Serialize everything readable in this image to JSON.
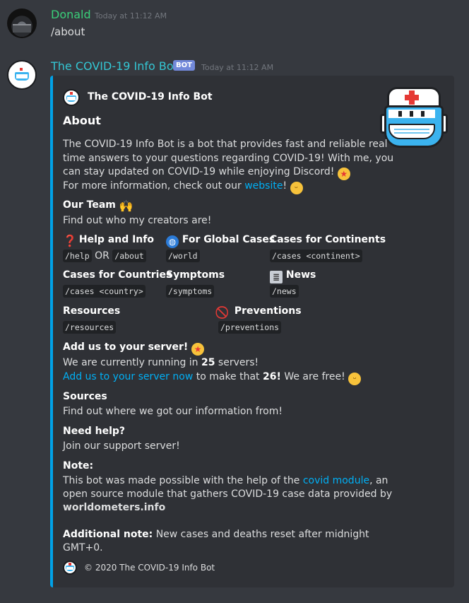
{
  "msg1": {
    "author": "Donald",
    "author_color": "#3ad07a",
    "timestamp": "Today at 11:12 AM",
    "text": "/about"
  },
  "msg2": {
    "author": "The COVID-19 Info Bot",
    "author_color": "#34c6d3",
    "badge": "BOT",
    "timestamp": "Today at 11:12 AM"
  },
  "embed": {
    "accent_color": "#00a2e8",
    "author_name": "The COVID-19 Info Bot",
    "title": "About",
    "desc_line1": "The COVID-19 Info Bot is a bot that provides fast and reliable real",
    "desc_line2": "time answers to your questions regarding COVID-19! With me, you",
    "desc_line3": "can stay updated on COVID-19 while enjoying Discord!",
    "desc_line4_pre": "For more information, check out our ",
    "desc_line4_link": "website",
    "desc_line4_post": "!",
    "team_title": "Our Team",
    "team_link": "Find out who my creators are!",
    "help_title": "Help and Info",
    "help_cmd1": "/help",
    "help_or": "OR",
    "help_cmd2": "/about",
    "global_title": "For Global Cases",
    "global_cmd": "/world",
    "continents_title": "Cases for Continents",
    "continents_cmd": "/cases <continent>",
    "countries_title": "Cases for Countries",
    "countries_cmd": "/cases <country>",
    "symptoms_title": "Symptoms",
    "symptoms_cmd": "/symptoms",
    "news_title": "News",
    "news_cmd": "/news",
    "resources_title": "Resources",
    "resources_cmd": "/resources",
    "preventions_title": "Preventions",
    "preventions_cmd": "/preventions",
    "add_title": "Add us to your server!",
    "add_line1_pre": "We are currently running in ",
    "add_line1_num": "25",
    "add_line1_post": " servers!",
    "add_line2_link": "Add us to your server now",
    "add_line2_pre": " to make that ",
    "add_line2_num": "26!",
    "add_line2_post": " We are free!",
    "sources_title": "Sources",
    "sources_link": "Find out where we got our information from!",
    "needhelp_title": "Need help?",
    "needhelp_link": "Join our support server!",
    "note_title": "Note:",
    "note_line1_pre": "This bot was made possible with the help of the ",
    "note_line1_link": "covid module",
    "note_line1_post": ", an",
    "note_line2": "open source module that gathers COVID-19 case data provided by",
    "note_line3_link": "worldometers.info",
    "addnote_title": "Additional note:",
    "addnote_line1": " New cases and deaths reset after midnight",
    "addnote_line2": "GMT+0.",
    "footer": "© 2020 The COVID-19 Info Bot"
  },
  "icons": [
    "server-avatar",
    "bot-avatar",
    "mask-icon",
    "star-struck-emoji",
    "smiley-emoji",
    "raised-hands-emoji",
    "question-mark-emoji",
    "globe-emoji",
    "newspaper-emoji",
    "no-entry-emoji"
  ]
}
